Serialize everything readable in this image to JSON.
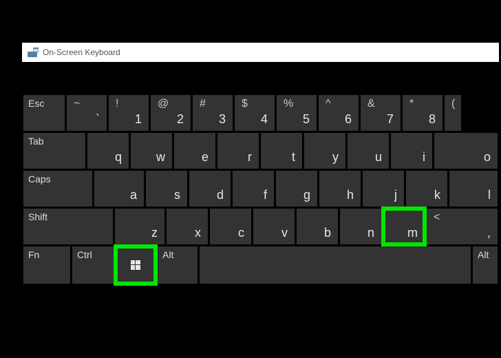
{
  "window": {
    "title": "On-Screen Keyboard"
  },
  "rows": {
    "r1": {
      "esc": "Esc",
      "k1": {
        "s": "~",
        "m": "`"
      },
      "k2": {
        "s": "!",
        "m": "1"
      },
      "k3": {
        "s": "@",
        "m": "2"
      },
      "k4": {
        "s": "#",
        "m": "3"
      },
      "k5": {
        "s": "$",
        "m": "4"
      },
      "k6": {
        "s": "%",
        "m": "5"
      },
      "k7": {
        "s": "^",
        "m": "6"
      },
      "k8": {
        "s": "&",
        "m": "7"
      },
      "k9": {
        "s": "*",
        "m": "8"
      },
      "k10": {
        "s": "("
      }
    },
    "r2": {
      "tab": "Tab",
      "q": "q",
      "w": "w",
      "e": "e",
      "r": "r",
      "t": "t",
      "y": "y",
      "u": "u",
      "i": "i",
      "o": "o"
    },
    "r3": {
      "caps": "Caps",
      "a": "a",
      "s": "s",
      "d": "d",
      "f": "f",
      "g": "g",
      "h": "h",
      "j": "j",
      "k": "k",
      "l": "l"
    },
    "r4": {
      "shift": "Shift",
      "z": "z",
      "x": "x",
      "c": "c",
      "v": "v",
      "b": "b",
      "n": "n",
      "m": "m",
      "comma": {
        "s": "<",
        "m": ","
      }
    },
    "r5": {
      "fn": "Fn",
      "ctrl": "Ctrl",
      "altL": "Alt",
      "altR": "Alt"
    }
  }
}
